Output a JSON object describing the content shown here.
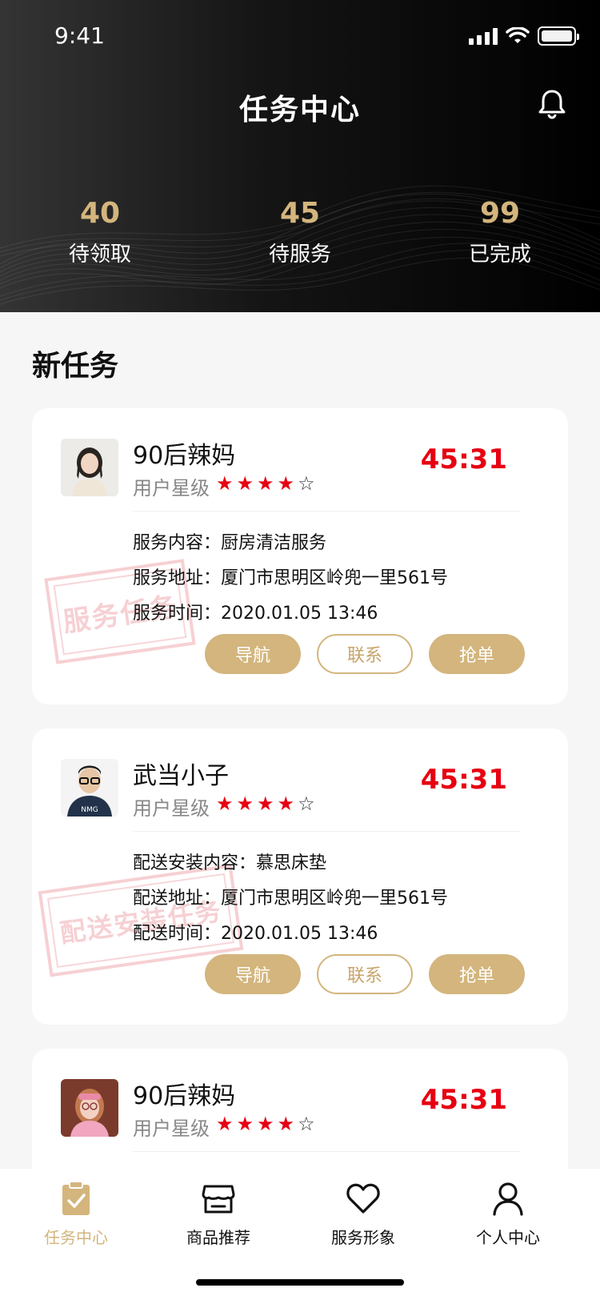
{
  "status": {
    "time": "9:41"
  },
  "header": {
    "title": "任务中心"
  },
  "stats": [
    {
      "value": "40",
      "label": "待领取"
    },
    {
      "value": "45",
      "label": "待服务"
    },
    {
      "value": "99",
      "label": "已完成"
    }
  ],
  "section_title": "新任务",
  "rank_label": "用户星级",
  "cards": [
    {
      "name": "90后辣妈",
      "stars": 4,
      "countdown": "45:31",
      "rows": [
        {
          "k": "服务内容：",
          "v": "厨房清洁服务"
        },
        {
          "k": "服务地址：",
          "v": "厦门市思明区岭兜一里561号"
        },
        {
          "k": "服务时间：",
          "v": "2020.01.05   13:46"
        }
      ],
      "stamp": "服务任务",
      "buttons": {
        "nav": "导航",
        "contact": "联系",
        "grab": "抢单"
      }
    },
    {
      "name": "武当小子",
      "stars": 4,
      "countdown": "45:31",
      "rows": [
        {
          "k": "配送安装内容：",
          "v": "慕思床垫"
        },
        {
          "k": "配送地址：",
          "v": "厦门市思明区岭兜一里561号"
        },
        {
          "k": "配送时间：",
          "v": "2020.01.05   13:46"
        }
      ],
      "stamp": "配送安装任务",
      "buttons": {
        "nav": "导航",
        "contact": "联系",
        "grab": "抢单"
      }
    },
    {
      "name": "90后辣妈",
      "stars": 4,
      "countdown": "45:31"
    }
  ],
  "tabs": [
    {
      "label": "任务中心",
      "icon": "clipboard-check-icon",
      "active": true
    },
    {
      "label": "商品推荐",
      "icon": "store-icon",
      "active": false
    },
    {
      "label": "服务形象",
      "icon": "heart-icon",
      "active": false
    },
    {
      "label": "个人中心",
      "icon": "user-icon",
      "active": false
    }
  ],
  "colors": {
    "accent": "#d3b57d",
    "countdown": "#e60012",
    "header_bg": "#000000"
  }
}
